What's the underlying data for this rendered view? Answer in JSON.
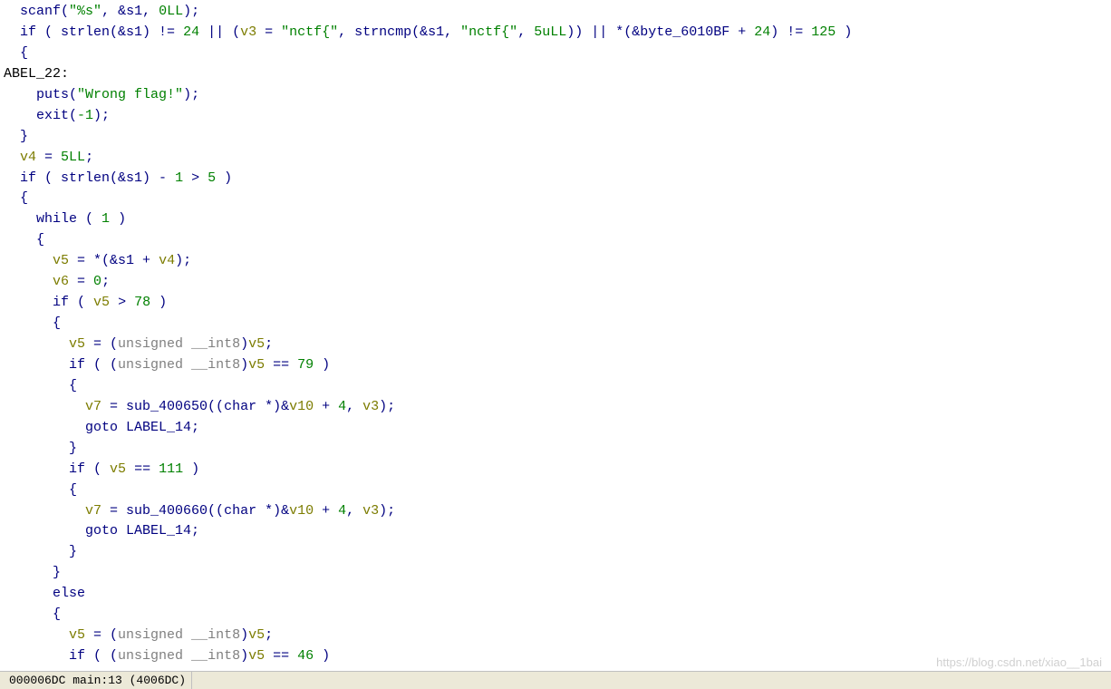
{
  "code": {
    "lines": [
      {
        "indent": 2,
        "segments": [
          {
            "t": "scanf",
            "c": "fn"
          },
          {
            "t": "(",
            "c": "punct"
          },
          {
            "t": "\"%s\"",
            "c": "str"
          },
          {
            "t": ", &s1, ",
            "c": "punct"
          },
          {
            "t": "0LL",
            "c": "num"
          },
          {
            "t": ");",
            "c": "punct"
          }
        ]
      },
      {
        "indent": 2,
        "segments": [
          {
            "t": "if",
            "c": "kw"
          },
          {
            "t": " ( strlen(&s1) != ",
            "c": "punct"
          },
          {
            "t": "24",
            "c": "num"
          },
          {
            "t": " || (",
            "c": "punct"
          },
          {
            "t": "v3",
            "c": "var"
          },
          {
            "t": " = ",
            "c": "punct"
          },
          {
            "t": "\"nctf{\"",
            "c": "str"
          },
          {
            "t": ", strncmp(&s1, ",
            "c": "punct"
          },
          {
            "t": "\"nctf{\"",
            "c": "str"
          },
          {
            "t": ", ",
            "c": "punct"
          },
          {
            "t": "5uLL",
            "c": "num"
          },
          {
            "t": ")) || *(&byte_6010BF + ",
            "c": "punct"
          },
          {
            "t": "24",
            "c": "num"
          },
          {
            "t": ") != ",
            "c": "punct"
          },
          {
            "t": "125",
            "c": "num"
          },
          {
            "t": " )",
            "c": "punct"
          }
        ]
      },
      {
        "indent": 2,
        "segments": [
          {
            "t": "{",
            "c": "punct"
          }
        ]
      },
      {
        "indent": 0,
        "segments": [
          {
            "t": "ABEL_22:",
            "c": "plain"
          }
        ]
      },
      {
        "indent": 4,
        "segments": [
          {
            "t": "puts(",
            "c": "punct"
          },
          {
            "t": "\"Wrong flag!\"",
            "c": "str"
          },
          {
            "t": ");",
            "c": "punct"
          }
        ]
      },
      {
        "indent": 4,
        "segments": [
          {
            "t": "exit(",
            "c": "punct"
          },
          {
            "t": "-1",
            "c": "num"
          },
          {
            "t": ");",
            "c": "punct"
          }
        ]
      },
      {
        "indent": 2,
        "segments": [
          {
            "t": "}",
            "c": "punct"
          }
        ]
      },
      {
        "indent": 2,
        "segments": [
          {
            "t": "v4",
            "c": "var"
          },
          {
            "t": " = ",
            "c": "punct"
          },
          {
            "t": "5LL",
            "c": "num"
          },
          {
            "t": ";",
            "c": "punct"
          }
        ]
      },
      {
        "indent": 2,
        "segments": [
          {
            "t": "if",
            "c": "kw"
          },
          {
            "t": " ( strlen(&s1) - ",
            "c": "punct"
          },
          {
            "t": "1",
            "c": "num"
          },
          {
            "t": " > ",
            "c": "punct"
          },
          {
            "t": "5",
            "c": "num"
          },
          {
            "t": " )",
            "c": "punct"
          }
        ]
      },
      {
        "indent": 2,
        "segments": [
          {
            "t": "{",
            "c": "punct"
          }
        ]
      },
      {
        "indent": 4,
        "segments": [
          {
            "t": "while",
            "c": "kw"
          },
          {
            "t": " ( ",
            "c": "punct"
          },
          {
            "t": "1",
            "c": "num"
          },
          {
            "t": " )",
            "c": "punct"
          }
        ]
      },
      {
        "indent": 4,
        "segments": [
          {
            "t": "{",
            "c": "punct"
          }
        ]
      },
      {
        "indent": 6,
        "segments": [
          {
            "t": "v5",
            "c": "var"
          },
          {
            "t": " = *(&s1 + ",
            "c": "punct"
          },
          {
            "t": "v4",
            "c": "var"
          },
          {
            "t": ");",
            "c": "punct"
          }
        ]
      },
      {
        "indent": 6,
        "segments": [
          {
            "t": "v6",
            "c": "var"
          },
          {
            "t": " = ",
            "c": "punct"
          },
          {
            "t": "0",
            "c": "num"
          },
          {
            "t": ";",
            "c": "punct"
          }
        ]
      },
      {
        "indent": 6,
        "segments": [
          {
            "t": "if",
            "c": "kw"
          },
          {
            "t": " ( ",
            "c": "punct"
          },
          {
            "t": "v5",
            "c": "var"
          },
          {
            "t": " > ",
            "c": "punct"
          },
          {
            "t": "78",
            "c": "num"
          },
          {
            "t": " )",
            "c": "punct"
          }
        ]
      },
      {
        "indent": 6,
        "segments": [
          {
            "t": "{",
            "c": "punct"
          }
        ]
      },
      {
        "indent": 8,
        "segments": [
          {
            "t": "v5",
            "c": "var"
          },
          {
            "t": " = (",
            "c": "punct"
          },
          {
            "t": "unsigned __int8",
            "c": "gray"
          },
          {
            "t": ")",
            "c": "punct"
          },
          {
            "t": "v5",
            "c": "var"
          },
          {
            "t": ";",
            "c": "punct"
          }
        ]
      },
      {
        "indent": 8,
        "segments": [
          {
            "t": "if",
            "c": "kw"
          },
          {
            "t": " ( (",
            "c": "punct"
          },
          {
            "t": "unsigned __int8",
            "c": "gray"
          },
          {
            "t": ")",
            "c": "punct"
          },
          {
            "t": "v5",
            "c": "var"
          },
          {
            "t": " == ",
            "c": "punct"
          },
          {
            "t": "79",
            "c": "num"
          },
          {
            "t": " )",
            "c": "punct"
          }
        ]
      },
      {
        "indent": 8,
        "segments": [
          {
            "t": "{",
            "c": "punct"
          }
        ]
      },
      {
        "indent": 10,
        "segments": [
          {
            "t": "v7",
            "c": "var"
          },
          {
            "t": " = sub_400650((",
            "c": "punct"
          },
          {
            "t": "char",
            "c": "kw"
          },
          {
            "t": " *)&",
            "c": "punct"
          },
          {
            "t": "v10",
            "c": "var"
          },
          {
            "t": " + ",
            "c": "punct"
          },
          {
            "t": "4",
            "c": "num"
          },
          {
            "t": ", ",
            "c": "punct"
          },
          {
            "t": "v3",
            "c": "var"
          },
          {
            "t": ");",
            "c": "punct"
          }
        ]
      },
      {
        "indent": 10,
        "segments": [
          {
            "t": "goto",
            "c": "kw"
          },
          {
            "t": " LABEL_14;",
            "c": "punct"
          }
        ]
      },
      {
        "indent": 8,
        "segments": [
          {
            "t": "}",
            "c": "punct"
          }
        ]
      },
      {
        "indent": 8,
        "segments": [
          {
            "t": "if",
            "c": "kw"
          },
          {
            "t": " ( ",
            "c": "punct"
          },
          {
            "t": "v5",
            "c": "var"
          },
          {
            "t": " == ",
            "c": "punct"
          },
          {
            "t": "111",
            "c": "num"
          },
          {
            "t": " )",
            "c": "punct"
          }
        ]
      },
      {
        "indent": 8,
        "segments": [
          {
            "t": "{",
            "c": "punct"
          }
        ]
      },
      {
        "indent": 10,
        "segments": [
          {
            "t": "v7",
            "c": "var"
          },
          {
            "t": " = sub_400660((",
            "c": "punct"
          },
          {
            "t": "char",
            "c": "kw"
          },
          {
            "t": " *)&",
            "c": "punct"
          },
          {
            "t": "v10",
            "c": "var"
          },
          {
            "t": " + ",
            "c": "punct"
          },
          {
            "t": "4",
            "c": "num"
          },
          {
            "t": ", ",
            "c": "punct"
          },
          {
            "t": "v3",
            "c": "var"
          },
          {
            "t": ");",
            "c": "punct"
          }
        ]
      },
      {
        "indent": 10,
        "segments": [
          {
            "t": "goto",
            "c": "kw"
          },
          {
            "t": " LABEL_14;",
            "c": "punct"
          }
        ]
      },
      {
        "indent": 8,
        "segments": [
          {
            "t": "}",
            "c": "punct"
          }
        ]
      },
      {
        "indent": 6,
        "segments": [
          {
            "t": "}",
            "c": "punct"
          }
        ]
      },
      {
        "indent": 6,
        "segments": [
          {
            "t": "else",
            "c": "kw"
          }
        ]
      },
      {
        "indent": 6,
        "segments": [
          {
            "t": "{",
            "c": "punct"
          }
        ]
      },
      {
        "indent": 8,
        "segments": [
          {
            "t": "v5",
            "c": "var"
          },
          {
            "t": " = (",
            "c": "punct"
          },
          {
            "t": "unsigned __int8",
            "c": "gray"
          },
          {
            "t": ")",
            "c": "punct"
          },
          {
            "t": "v5",
            "c": "var"
          },
          {
            "t": ";",
            "c": "punct"
          }
        ]
      },
      {
        "indent": 8,
        "segments": [
          {
            "t": "if",
            "c": "kw"
          },
          {
            "t": " ( (",
            "c": "punct"
          },
          {
            "t": "unsigned __int8",
            "c": "gray"
          },
          {
            "t": ")",
            "c": "punct"
          },
          {
            "t": "v5",
            "c": "var"
          },
          {
            "t": " == ",
            "c": "punct"
          },
          {
            "t": "46",
            "c": "num"
          },
          {
            "t": " )",
            "c": "punct"
          }
        ]
      }
    ]
  },
  "status": {
    "text": "000006DC main:13 (4006DC)"
  },
  "watermark": "https://blog.csdn.net/xiao__1bai"
}
